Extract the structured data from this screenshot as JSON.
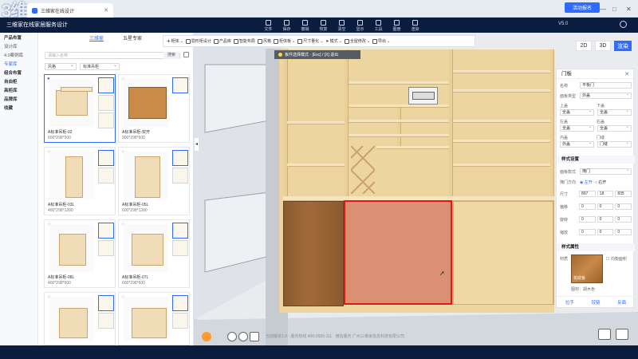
{
  "browser": {
    "tab_title": "三维家在线设计",
    "watermark": "3维",
    "window_controls": [
      "—",
      "□",
      "✕"
    ]
  },
  "header": {
    "brand": "三维家在线家居服务设计",
    "menu": [
      {
        "label": "文件",
        "icon": "file-icon"
      },
      {
        "label": "保存",
        "icon": "save-icon"
      },
      {
        "label": "撤销",
        "icon": "undo-icon"
      },
      {
        "label": "恢复",
        "icon": "redo-icon"
      },
      {
        "label": "清空",
        "icon": "clear-icon"
      },
      {
        "label": "显示",
        "icon": "eye-icon"
      },
      {
        "label": "工具",
        "icon": "tool-icon"
      },
      {
        "label": "图册",
        "icon": "album-icon"
      },
      {
        "label": "渲染",
        "icon": "render-icon"
      }
    ],
    "login_button": "活动报名",
    "version": "V5.0"
  },
  "left_nav": {
    "items": [
      {
        "label": "产品布置",
        "type": "header"
      },
      {
        "label": "设计库",
        "type": "item"
      },
      {
        "label": "4.0案例库",
        "type": "item"
      },
      {
        "label": "专家库",
        "type": "item",
        "active": true
      },
      {
        "label": "组合布置",
        "type": "header"
      },
      {
        "label": "自由柜",
        "type": "header"
      },
      {
        "label": "高柜库",
        "type": "header"
      },
      {
        "label": "品牌库",
        "type": "header"
      },
      {
        "label": "收藏",
        "type": "header"
      }
    ]
  },
  "panel": {
    "tabs": [
      {
        "label": "三维家",
        "active": true
      },
      {
        "label": "五星专家",
        "active": false
      }
    ],
    "search_placeholder": "请输入名称",
    "search_button": "搜索",
    "filter_1": "风格",
    "filter_2": "标准吊柜",
    "cards": [
      {
        "name": "A标准吊柜-02",
        "size": "600*298*500",
        "selected": true
      },
      {
        "name": "A标准吊柜-双开",
        "size": "900*298*600",
        "selected": false
      },
      {
        "name": "A标准吊柜-03L",
        "size": "400*298*1200",
        "selected": false
      },
      {
        "name": "A标准吊柜-05L",
        "size": "600*298*1200",
        "selected": false
      },
      {
        "name": "A标准吊柜-08L",
        "size": "400*298*600",
        "selected": false
      },
      {
        "name": "A标准吊柜-07L",
        "size": "600*298*600",
        "selected": false
      },
      {
        "name": "",
        "size": "",
        "selected": false
      },
      {
        "name": "",
        "size": "",
        "selected": false
      }
    ]
  },
  "toolbar": {
    "items": [
      {
        "label": "柜体",
        "icon": "plus-icon"
      },
      {
        "label": "隐形柜设计",
        "icon": "hidden-cabinet-icon"
      },
      {
        "label": "产品库",
        "icon": "product-icon"
      },
      {
        "label": "智能布局",
        "icon": "smart-layout-icon"
      },
      {
        "label": "风格",
        "icon": "style-icon"
      },
      {
        "label": "柜体板",
        "icon": "panel-icon"
      },
      {
        "label": "尺寸量化",
        "icon": "measure-icon"
      },
      {
        "label": "模式",
        "icon": "cursor-icon"
      },
      {
        "label": "全屋修改",
        "icon": "edit-icon"
      },
      {
        "label": "导出",
        "icon": "export-icon"
      }
    ]
  },
  "toast": {
    "text": "板件选择模式 · [Esc] / [X] 退出"
  },
  "view_toggle": {
    "mode_2d": "2D",
    "mode_3d": "3D",
    "render": "渲染"
  },
  "right_panel": {
    "title": "门板",
    "name_label": "名称",
    "name_value": "平板门",
    "panel_type_label": "面板类型",
    "panel_type_value": "外盖",
    "top_label": "上盖",
    "top_value": "全盖",
    "bottom_label": "下盖",
    "bottom_value": "全盖",
    "left_label": "左盖",
    "left_value": "全盖",
    "right_label": "右盖",
    "right_value": "全盖",
    "inner_label": "内盖",
    "inner_value": "外盖",
    "door_label": "门缝",
    "door_value": "门缝",
    "section_style": "样式设置",
    "door_type_label": "面板款式",
    "door_type_value": "掩门",
    "open_dir_label": "掩门方向",
    "open_left": "左开",
    "open_right": "右开",
    "dim_label": "尺寸",
    "dim_w": "897",
    "dim_d": "18",
    "dim_h": "835",
    "offset_label": "偏移",
    "rotate_label": "旋转",
    "scale_label": "缩放",
    "zero": "0",
    "section_material": "样式属性",
    "material_label": "材质",
    "material_name": "花纹板",
    "material_sub": "图材：胡木色",
    "lock_label": "均衡面积",
    "footer": [
      "拉手",
      "铰链",
      "反面"
    ]
  },
  "bottom_bar": {
    "status": "当前版本1.0 · 服务热线 400-0920-111 · 微信服务 广州三维家信息科技有限公司"
  }
}
